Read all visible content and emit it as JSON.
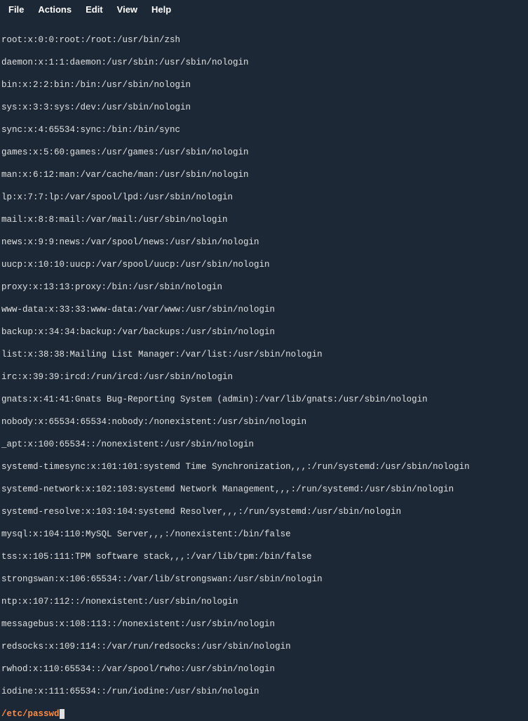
{
  "menubar": {
    "items": [
      {
        "label": "File"
      },
      {
        "label": "Actions"
      },
      {
        "label": "Edit"
      },
      {
        "label": "View"
      },
      {
        "label": "Help"
      }
    ]
  },
  "lines": [
    "root:x:0:0:root:/root:/usr/bin/zsh",
    "daemon:x:1:1:daemon:/usr/sbin:/usr/sbin/nologin",
    "bin:x:2:2:bin:/bin:/usr/sbin/nologin",
    "sys:x:3:3:sys:/dev:/usr/sbin/nologin",
    "sync:x:4:65534:sync:/bin:/bin/sync",
    "games:x:5:60:games:/usr/games:/usr/sbin/nologin",
    "man:x:6:12:man:/var/cache/man:/usr/sbin/nologin",
    "lp:x:7:7:lp:/var/spool/lpd:/usr/sbin/nologin",
    "mail:x:8:8:mail:/var/mail:/usr/sbin/nologin",
    "news:x:9:9:news:/var/spool/news:/usr/sbin/nologin",
    "uucp:x:10:10:uucp:/var/spool/uucp:/usr/sbin/nologin",
    "proxy:x:13:13:proxy:/bin:/usr/sbin/nologin",
    "www-data:x:33:33:www-data:/var/www:/usr/sbin/nologin",
    "backup:x:34:34:backup:/var/backups:/usr/sbin/nologin",
    "list:x:38:38:Mailing List Manager:/var/list:/usr/sbin/nologin",
    "irc:x:39:39:ircd:/run/ircd:/usr/sbin/nologin",
    "gnats:x:41:41:Gnats Bug-Reporting System (admin):/var/lib/gnats:/usr/sbin/nologin",
    "nobody:x:65534:65534:nobody:/nonexistent:/usr/sbin/nologin",
    "_apt:x:100:65534::/nonexistent:/usr/sbin/nologin",
    "systemd-timesync:x:101:101:systemd Time Synchronization,,,:/run/systemd:/usr/sbin/nologin",
    "systemd-network:x:102:103:systemd Network Management,,,:/run/systemd:/usr/sbin/nologin",
    "systemd-resolve:x:103:104:systemd Resolver,,,:/run/systemd:/usr/sbin/nologin",
    "mysql:x:104:110:MySQL Server,,,:/nonexistent:/bin/false",
    "tss:x:105:111:TPM software stack,,,:/var/lib/tpm:/bin/false",
    "strongswan:x:106:65534::/var/lib/strongswan:/usr/sbin/nologin",
    "ntp:x:107:112::/nonexistent:/usr/sbin/nologin",
    "messagebus:x:108:113::/nonexistent:/usr/sbin/nologin",
    "redsocks:x:109:114::/var/run/redsocks:/usr/sbin/nologin",
    "rwhod:x:110:65534::/var/spool/rwho:/usr/sbin/nologin",
    "iodine:x:111:65534::/run/iodine:/usr/sbin/nologin"
  ],
  "status": "/etc/passwd"
}
